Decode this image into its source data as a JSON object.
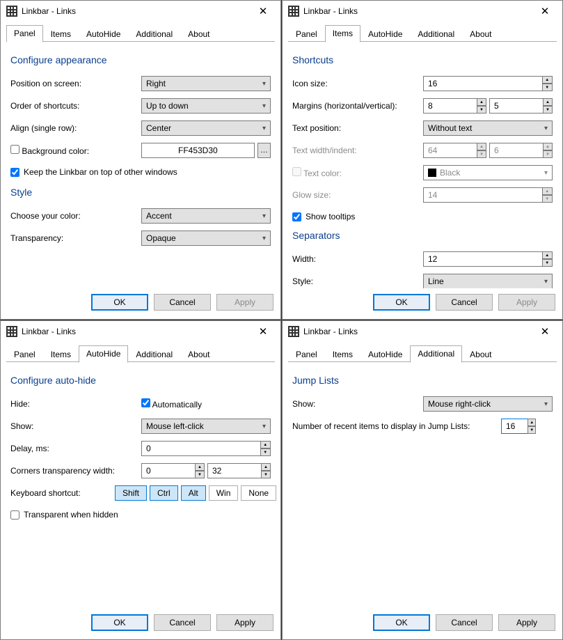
{
  "title": "Linkbar - Links",
  "tabs": [
    "Panel",
    "Items",
    "AutoHide",
    "Additional",
    "About"
  ],
  "buttons": {
    "ok": "OK",
    "cancel": "Cancel",
    "apply": "Apply"
  },
  "panel": {
    "h1": "Configure appearance",
    "pos_label": "Position on screen:",
    "pos_value": "Right",
    "order_label": "Order of shortcuts:",
    "order_value": "Up to down",
    "align_label": "Align (single row):",
    "align_value": "Center",
    "bg_label": "Background color:",
    "bg_value": "FF453D30",
    "ontop_label": "Keep the Linkbar on top of other windows",
    "h2": "Style",
    "color_label": "Choose your color:",
    "color_value": "Accent",
    "trans_label": "Transparency:",
    "trans_value": "Opaque"
  },
  "items": {
    "h1": "Shortcuts",
    "icon_label": "Icon size:",
    "icon_value": "16",
    "margins_label": "Margins (horizontal/vertical):",
    "margins_h": "8",
    "margins_v": "5",
    "textpos_label": "Text position:",
    "textpos_value": "Without text",
    "textw_label": "Text width/indent:",
    "textw_w": "64",
    "textw_i": "6",
    "textcolor_label": "Text color:",
    "textcolor_value": "Black",
    "glow_label": "Glow size:",
    "glow_value": "14",
    "tooltips_label": "Show tooltips",
    "h2": "Separators",
    "sepw_label": "Width:",
    "sepw_value": "12",
    "sepstyle_label": "Style:",
    "sepstyle_value": "Line"
  },
  "autohide": {
    "h1": "Configure auto-hide",
    "hide_label": "Hide:",
    "hide_cb": "Automatically",
    "show_label": "Show:",
    "show_value": "Mouse left-click",
    "delay_label": "Delay, ms:",
    "delay_value": "0",
    "corners_label": "Corners transparency width:",
    "corners_a": "0",
    "corners_b": "32",
    "kb_label": "Keyboard shortcut:",
    "shift": "Shift",
    "ctrl": "Ctrl",
    "alt": "Alt",
    "win": "Win",
    "none": "None",
    "transhid_label": "Transparent when hidden"
  },
  "additional": {
    "h1": "Jump Lists",
    "show_label": "Show:",
    "show_value": "Mouse right-click",
    "recent_label": "Number of recent items to display in Jump Lists:",
    "recent_value": "16"
  }
}
